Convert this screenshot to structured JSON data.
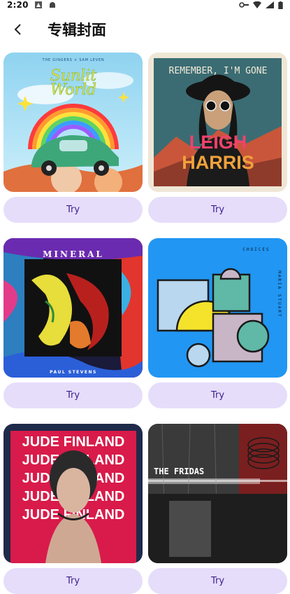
{
  "status_bar": {
    "time": "2:20"
  },
  "header": {
    "title": "专辑封面"
  },
  "covers": [
    {
      "artist_line": "THE GINGERS × SAM LEVEN",
      "title_line1": "Sunlit",
      "title_line2": "World",
      "try_label": "Try"
    },
    {
      "top_text": "REMEMBER, I'M GONE",
      "name_line1": "LEIGH",
      "name_line2": "HARRIS",
      "try_label": "Try"
    },
    {
      "title": "MINERAL",
      "artist": "PAUL STEVENS",
      "try_label": "Try"
    },
    {
      "title": "CHOICES",
      "artist": "MARIA STUART",
      "try_label": "Try"
    },
    {
      "repeat_text": "JUDE FINLAND",
      "try_label": "Try"
    },
    {
      "title": "THE FRIDAS",
      "try_label": "Try"
    }
  ],
  "colors": {
    "try_bg": "#e6ddfb",
    "try_text": "#3a1e8c",
    "choices_bg": "#2196f3",
    "jude_bg": "#d81b4a"
  }
}
